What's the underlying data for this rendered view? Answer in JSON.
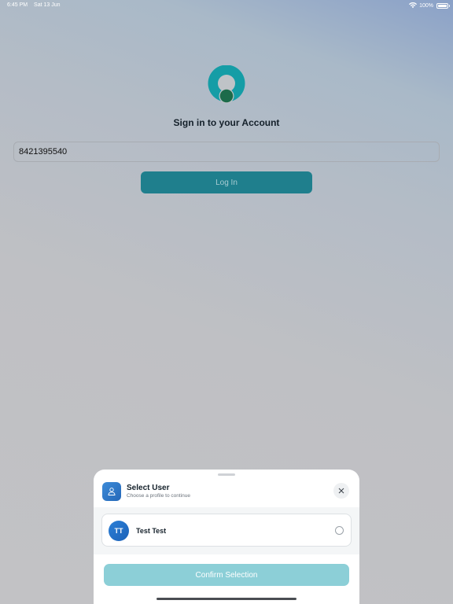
{
  "status_bar": {
    "time": "6:45 PM",
    "date": "Sat 13 Jun",
    "battery": "100%",
    "battery_level": 1.0,
    "wifi_icon": "wifi-icon"
  },
  "login": {
    "logo_icon": "app-logo-icon",
    "title": "Sign in to your Account",
    "phone_value": "8421395540",
    "login_label": "Log In"
  },
  "sheet": {
    "title": "Select User",
    "subtitle": "Choose a profile to continue",
    "users": [
      {
        "initials": "TT",
        "name": "Test Test",
        "selected": false
      }
    ],
    "confirm_label": "Confirm Selection"
  },
  "colors": {
    "primary": "#1f7f8d",
    "confirm_disabled": "#8ccfd7",
    "accent_blue": "#2568b8",
    "logo_teal": "#159da6",
    "logo_green": "#1c6b4a"
  }
}
